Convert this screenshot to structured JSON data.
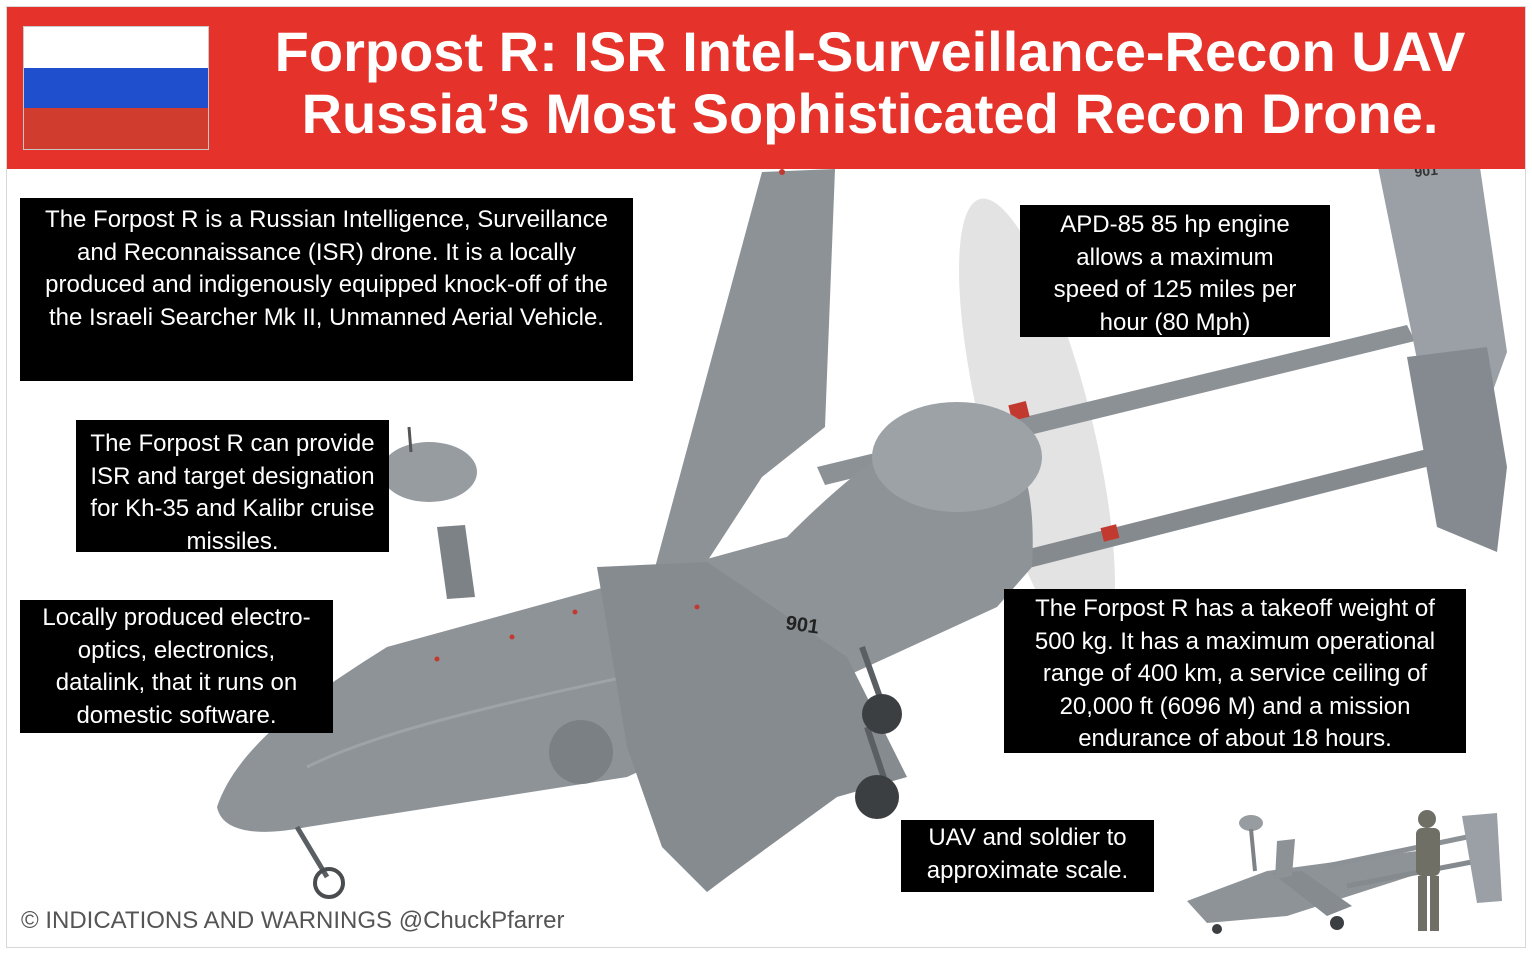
{
  "header": {
    "title_line1": "Forpost R: ISR Intel-Surveillance-Recon UAV",
    "title_line2": "Russia’s Most Sophisticated Recon Drone.",
    "banner_color": "#e5322a",
    "flag_colors": [
      "#ffffff",
      "#1f4fcc",
      "#d03c2e"
    ]
  },
  "notes": {
    "intro": "The Forpost R is a Russian Intelligence, Surveillance and Reconnaissance (ISR) drone. It is a locally produced and indigenously equipped knock-off of the the Israeli Searcher Mk II, Unmanned Aerial Vehicle.",
    "targeting": "The Forpost R can provide ISR and target designation for Kh-35 and Kalibr cruise missiles.",
    "electronics": "Locally produced electro-optics, electronics, datalink, that it runs on domestic software.",
    "engine": "APD-85 85 hp engine allows a  maximum speed of 125 miles per hour (80 Mph)",
    "performance": "The Forpost R has a takeoff weight of 500 kg. It has a maximum operational range of 400 km, a service ceiling of 20,000 ft (6096 M) and a mission endurance of about 18 hours.",
    "scale": "UAV and soldier to approximate scale."
  },
  "aircraft": {
    "tail_number": "901",
    "fin_number": "901",
    "body_color": "#8a8f94"
  },
  "footer": {
    "credit": "© INDICATIONS AND WARNINGS @ChuckPfarrer"
  }
}
